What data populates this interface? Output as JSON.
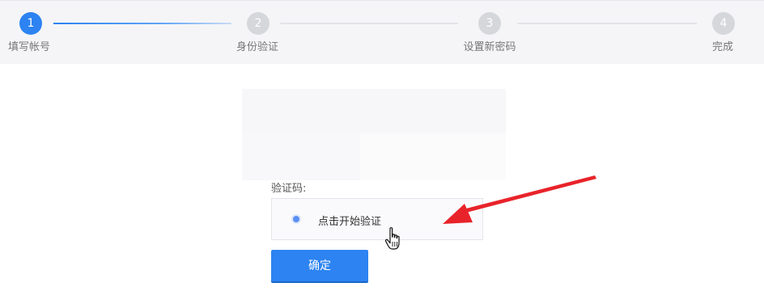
{
  "steps": [
    {
      "number": "1",
      "label": "填写帐号"
    },
    {
      "number": "2",
      "label": "身份验证"
    },
    {
      "number": "3",
      "label": "设置新密码"
    },
    {
      "number": "4",
      "label": "完成"
    }
  ],
  "form": {
    "captcha_label": "验证码:",
    "captcha_prompt": "点击开始验证",
    "confirm_label": "确定"
  },
  "colors": {
    "accent": "#2c83f1",
    "inactive_step": "#d6d7db",
    "annotation_arrow": "#e8232a"
  },
  "icons": {
    "cursor": "hand-pointer-icon",
    "annotation": "red-arrow-icon"
  }
}
